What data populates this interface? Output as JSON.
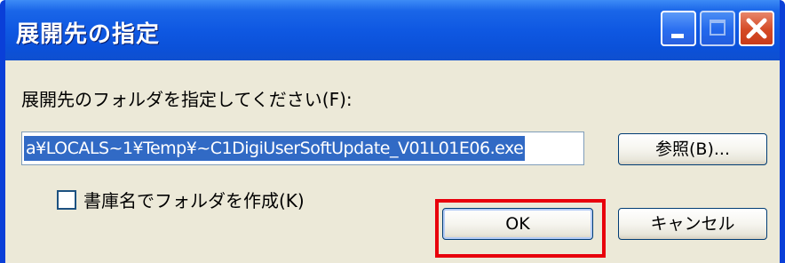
{
  "dialog": {
    "title": "展開先の指定",
    "prompt": "展開先のフォルダを指定してください(F):",
    "path_value": "a¥LOCALS~1¥Temp¥~C1DigiUserSoftUpdate_V01L01E06.exe",
    "browse_label": "参照(B)...",
    "checkbox_label": "書庫名でフォルダを作成(K)",
    "checkbox_checked": false,
    "ok_label": "OK",
    "cancel_label": "キャンセル"
  },
  "colors": {
    "titlebar": "#0b51d9",
    "face": "#ece9d8",
    "selection": "#316ac5",
    "highlight_box": "#e8000c"
  },
  "icons": [
    "minimize-icon",
    "maximize-icon",
    "close-icon"
  ]
}
